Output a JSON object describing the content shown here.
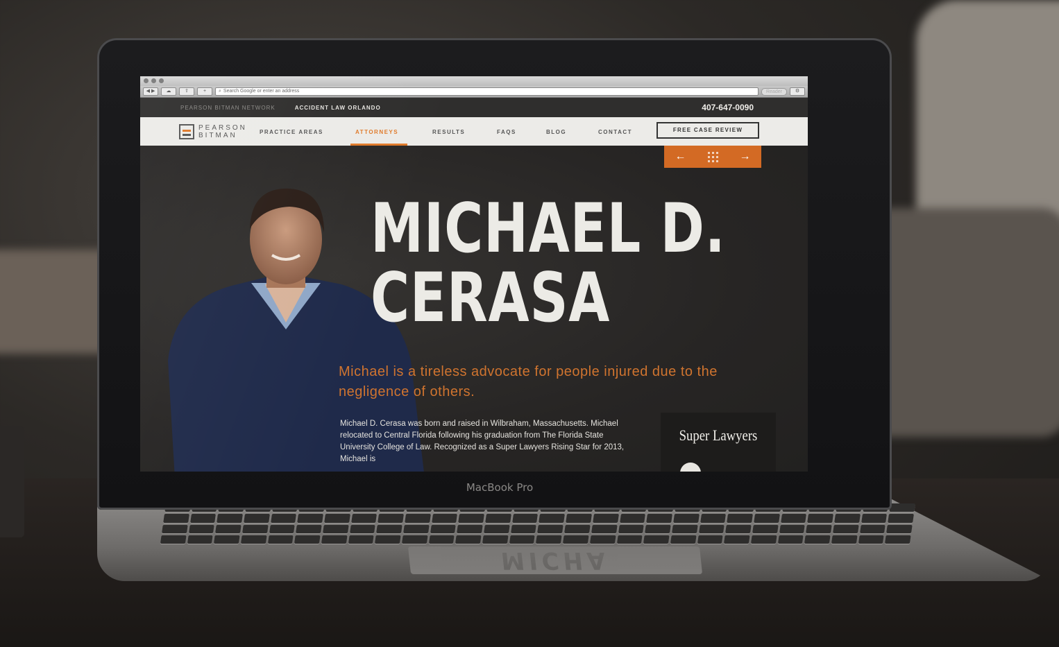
{
  "device": {
    "label": "MacBook Pro",
    "trackpad_reflection": "MICHA"
  },
  "browser": {
    "address_placeholder": "Search Google or enter an address",
    "reader_label": "Reader"
  },
  "network_bar": {
    "network_name": "PEARSON BITMAN NETWORK",
    "site_link": "ACCIDENT LAW ORLANDO",
    "phone": "407-647-0090"
  },
  "nav": {
    "logo_line1": "PEARSON",
    "logo_line2": "BITMAN",
    "items": [
      "PRACTICE  AREAS",
      "ATTORNEYS",
      "RESULTS",
      "FAQS",
      "BLOG",
      "CONTACT"
    ],
    "active": "ATTORNEYS",
    "cta": "FREE CASE REVIEW"
  },
  "hero": {
    "name_line1": "MICHAEL D.",
    "name_line2": "CERASA",
    "tagline": "Michael is a tireless advocate for people injured due to the negligence of others.",
    "bio": "Michael D. Cerasa was born and raised in Wilbraham, Massachusetts. Michael relocated to Central Florida following his graduation from The Florida State University College of Law. Recognized as a Super Lawyers Rising Star for 2013, Michael is",
    "badge": "Super Lawyers"
  },
  "pager": {
    "prev_icon": "arrow-left-icon",
    "grid_icon": "grid-dots-icon",
    "next_icon": "arrow-right-icon"
  },
  "colors": {
    "accent": "#e07a2a",
    "dark_bg": "#262524",
    "nav_bg": "#ecebe8"
  }
}
